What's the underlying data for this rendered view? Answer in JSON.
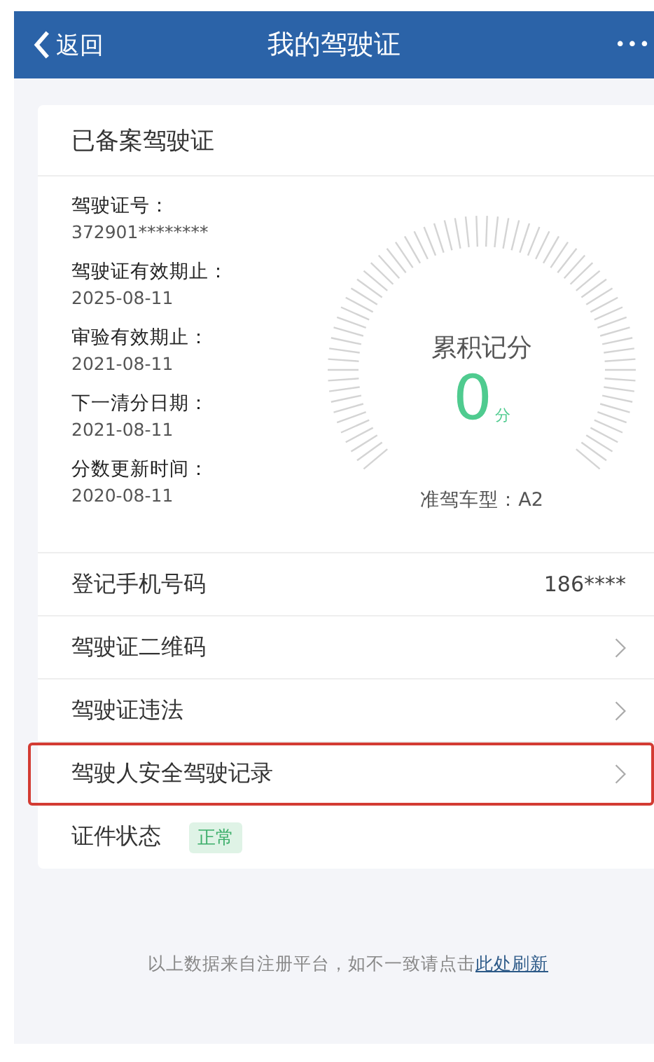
{
  "nav": {
    "back_label": "返回",
    "title": "我的驾驶证",
    "more": "•••"
  },
  "card": {
    "title": "已备案驾驶证",
    "fields": [
      {
        "label": "驾驶证号：",
        "value": "372901********"
      },
      {
        "label": "驾驶证有效期止：",
        "value": "2025-08-11"
      },
      {
        "label": "审验有效期止：",
        "value": "2021-08-11"
      },
      {
        "label": "下一清分日期：",
        "value": "2021-08-11"
      },
      {
        "label": "分数更新时间：",
        "value": "2020-08-11"
      }
    ],
    "gauge": {
      "title": "累积记分",
      "score": "0",
      "unit": "分",
      "vehicle_class": "准驾车型：A2"
    },
    "rows": [
      {
        "kind": "value",
        "label": "登记手机号码",
        "value": "186****",
        "highlighted": false
      },
      {
        "kind": "link",
        "label": "驾驶证二维码",
        "highlighted": false
      },
      {
        "kind": "link",
        "label": "驾驶证违法",
        "highlighted": false
      },
      {
        "kind": "link",
        "label": "驾驶人安全驾驶记录",
        "highlighted": true
      },
      {
        "kind": "badge",
        "label": "证件状态",
        "badge": "正常",
        "highlighted": false
      }
    ]
  },
  "footer": {
    "text": "以上数据来自注册平台，如不一致请点击",
    "link": "此处刷新"
  }
}
